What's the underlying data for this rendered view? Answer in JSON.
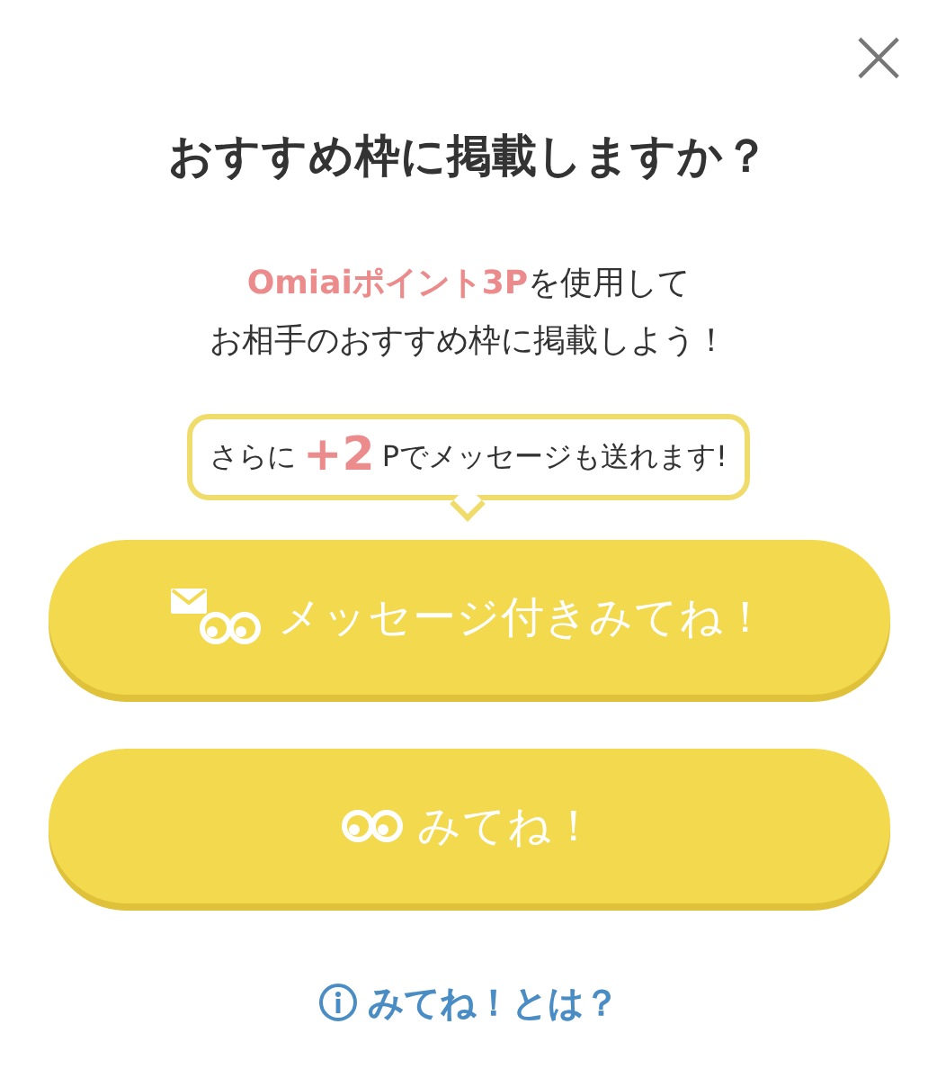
{
  "close": {
    "label": "×"
  },
  "title": "おすすめ枠に掲載しますか？",
  "intro": [
    {
      "parts": [
        {
          "text": "Omiaiポイント3P",
          "accent": true
        },
        {
          "text": "を使用して",
          "accent": false
        }
      ]
    },
    {
      "parts": [
        {
          "text": "お相手のおすすめ枠に掲載しよう！",
          "accent": false
        }
      ]
    }
  ],
  "bubble": {
    "parts": [
      {
        "text": "さらに",
        "kind": "plain"
      },
      {
        "text": "+2",
        "kind": "big"
      },
      {
        "text": "Pでメッセージも送れます!",
        "kind": "plain"
      }
    ]
  },
  "buttons": [
    {
      "label": "メッセージ付きみてね！",
      "kind": "message"
    },
    {
      "label": "みてね！",
      "kind": "plain"
    }
  ],
  "help_link": {
    "label": "みてね！とは？"
  }
}
